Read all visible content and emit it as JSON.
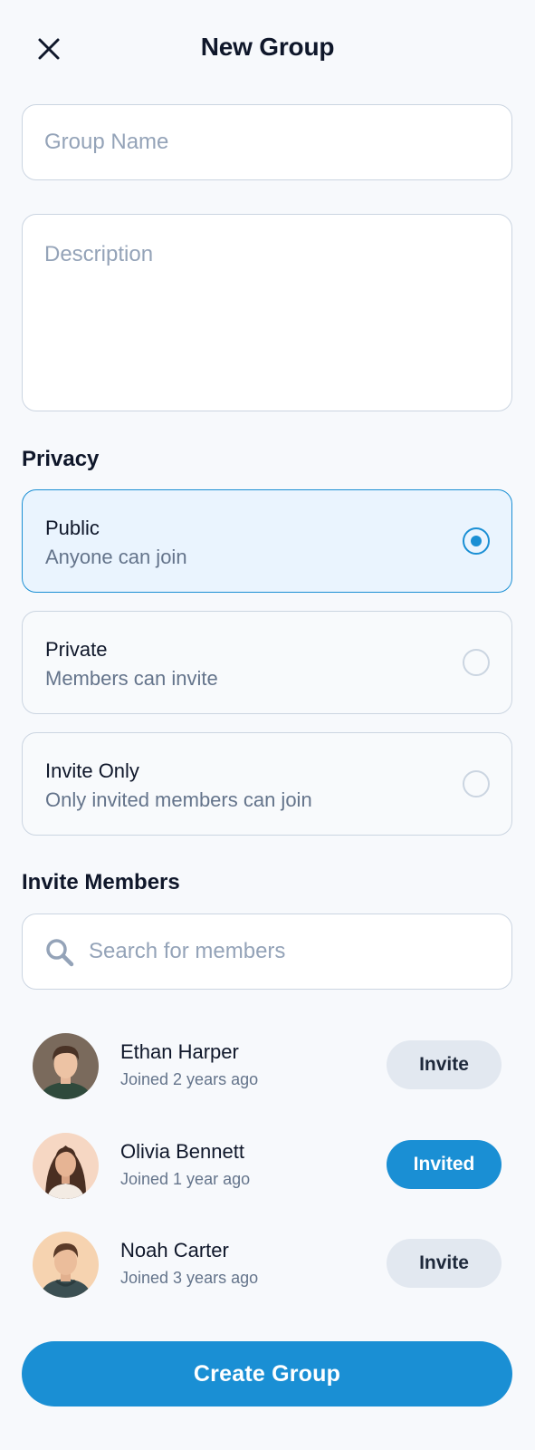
{
  "header": {
    "title": "New Group",
    "close_icon": "close-icon"
  },
  "form": {
    "group_name": {
      "value": "",
      "placeholder": "Group Name"
    },
    "description": {
      "value": "",
      "placeholder": "Description"
    }
  },
  "privacy": {
    "label": "Privacy",
    "selected": "public",
    "options": [
      {
        "id": "public",
        "title": "Public",
        "subtitle": "Anyone can join",
        "selected": true
      },
      {
        "id": "private",
        "title": "Private",
        "subtitle": "Members can invite",
        "selected": false
      },
      {
        "id": "invite_only",
        "title": "Invite Only",
        "subtitle": "Only invited members can join",
        "selected": false
      }
    ]
  },
  "invite_members": {
    "label": "Invite Members",
    "search": {
      "value": "",
      "placeholder": "Search for members",
      "icon": "search-icon"
    },
    "members": [
      {
        "name": "Ethan Harper",
        "joined": "Joined 2 years ago",
        "button_label": "Invite",
        "invited": false
      },
      {
        "name": "Olivia Bennett",
        "joined": "Joined 1 year ago",
        "button_label": "Invited",
        "invited": true
      },
      {
        "name": "Noah Carter",
        "joined": "Joined 3 years ago",
        "button_label": "Invite",
        "invited": false
      }
    ]
  },
  "create_button_label": "Create Group",
  "colors": {
    "accent": "#1a8fd4",
    "background": "#f7f9fc",
    "selected_option_bg": "#eaf4fe",
    "invite_button_bg": "#e2e8f0",
    "border": "#cbd5e1"
  }
}
